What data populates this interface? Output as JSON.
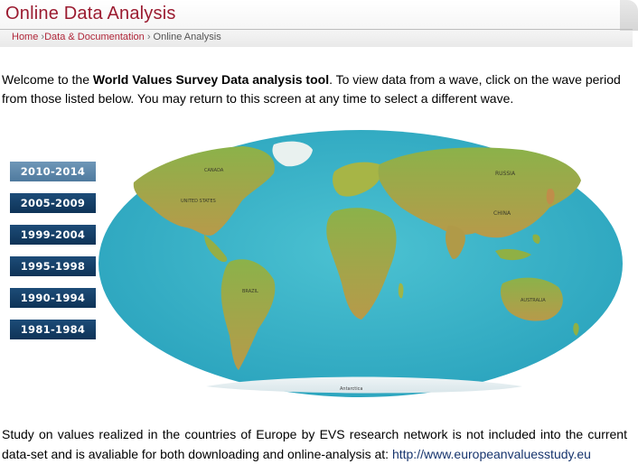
{
  "header": {
    "title": "Online Data Analysis",
    "breadcrumb": {
      "home": "Home",
      "sep1": "›",
      "data_docs": "Data & Documentation",
      "sep2": "›",
      "current": "Online Analysis"
    }
  },
  "intro": {
    "prefix": "Welcome to the ",
    "bold": "World Values Survey Data analysis tool",
    "suffix": ". To view data from a wave, click on the wave period from those listed below. You may return to this screen at any time to select a different wave."
  },
  "waves": [
    {
      "label": "2010-2014",
      "selected": true
    },
    {
      "label": "2005-2009",
      "selected": false
    },
    {
      "label": "1999-2004",
      "selected": false
    },
    {
      "label": "1995-1998",
      "selected": false
    },
    {
      "label": "1990-1994",
      "selected": false
    },
    {
      "label": "1981-1984",
      "selected": false
    }
  ],
  "map": {
    "labels": {
      "russia": "RUSSIA",
      "china": "CHINA",
      "brazil": "BRAZIL",
      "australia": "AUSTRALIA",
      "antarctica": "Antarctica",
      "united_states": "UNITED STATES",
      "canada": "CANADA"
    }
  },
  "footer": {
    "text": "Study on values realized in the countries of Europe by EVS research network is not included into the current data-set and is avaliable for both downloading and online-analysis at: ",
    "link": "http://www.europeanvaluesstudy.eu"
  },
  "colors": {
    "title": "#9b1b30",
    "breadcrumb_link": "#b0283a",
    "wave_button": "#163f68",
    "wave_selected": "#5f89ad",
    "link": "#17356e",
    "ocean": "#3fb6c8"
  }
}
